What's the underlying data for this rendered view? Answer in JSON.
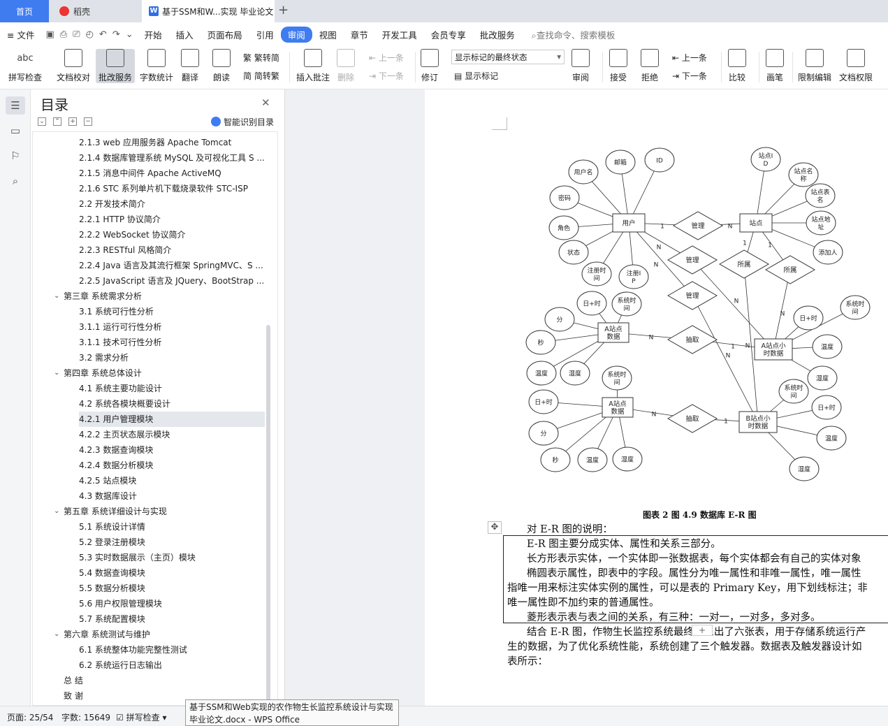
{
  "tabs": {
    "home": "首页",
    "daoke": "稻壳",
    "doc": "基于SSM和W...实现 毕业论文",
    "plus": "+"
  },
  "menu": {
    "file": "文件",
    "items": [
      "开始",
      "插入",
      "页面布局",
      "引用",
      "审阅",
      "视图",
      "章节",
      "开发工具",
      "会员专享",
      "批改服务"
    ],
    "active": "审阅",
    "search": "查找命令、搜索模板"
  },
  "ribbon": {
    "spell": "拼写检查",
    "spell_icon": "abc",
    "proof": "文档校对",
    "review_service": "批改服务",
    "wordcount": "字数统计",
    "translate": "翻译",
    "read": "朗读",
    "trad": "繁转简",
    "simp": "简转繁",
    "insert_comment": "插入批注",
    "delete": "删除",
    "prev": "上一条",
    "next": "下一条",
    "revise": "修订",
    "show_mark": "显示标记",
    "mark_state": "显示标记的最终状态",
    "review": "审阅",
    "accept": "接受",
    "reject": "拒绝",
    "prev2": "上一条",
    "next2": "下一条",
    "compare": "比较",
    "pen": "画笔",
    "restrict": "限制编辑",
    "perm": "文档权限"
  },
  "nav": {
    "title": "目录",
    "smart_toc": "智能识别目录",
    "items": [
      {
        "text": "2.1.3 web 应用服务器 Apache Tomcat",
        "level": 3
      },
      {
        "text": "2.1.4 数据库管理系统 MySQL 及可视化工具 S ...",
        "level": 3
      },
      {
        "text": "2.1.5 消息中间件 Apache ActiveMQ",
        "level": 3
      },
      {
        "text": "2.1.6 STC 系列单片机下载烧录软件 STC-ISP",
        "level": 3
      },
      {
        "text": "2.2  开发技术简介",
        "level": 3
      },
      {
        "text": "2.2.1 HTTP 协议简介",
        "level": 3
      },
      {
        "text": "2.2.2 WebSocket 协议简介",
        "level": 3
      },
      {
        "text": "2.2.3 RESTful 风格简介",
        "level": 3
      },
      {
        "text": "2.2.4 Java 语言及其流行框架 SpringMVC、S ...",
        "level": 3
      },
      {
        "text": "2.2.5 JavaScript 语言及 JQuery、BootStrap ...",
        "level": 3
      },
      {
        "text": "第三章  系统需求分析",
        "level": 1
      },
      {
        "text": "3.1  系统可行性分析",
        "level": 3
      },
      {
        "text": "3.1.1  运行可行性分析",
        "level": 3
      },
      {
        "text": "3.1.1  技术可行性分析",
        "level": 3
      },
      {
        "text": "3.2  需求分析",
        "level": 3
      },
      {
        "text": "第四章  系统总体设计",
        "level": 1
      },
      {
        "text": "4.1  系统主要功能设计",
        "level": 3
      },
      {
        "text": "4.2  系统各模块概要设计",
        "level": 3
      },
      {
        "text": "4.2.1  用户管理模块",
        "level": 3,
        "selected": true
      },
      {
        "text": "4.2.2  主页状态展示模块",
        "level": 3
      },
      {
        "text": "4.2.3  数据查询模块",
        "level": 3
      },
      {
        "text": "4.2.4  数据分析模块",
        "level": 3
      },
      {
        "text": "4.2.5  站点模块",
        "level": 3
      },
      {
        "text": "4.3  数据库设计",
        "level": 3
      },
      {
        "text": "第五章  系统详细设计与实现",
        "level": 1
      },
      {
        "text": "5.1  系统设计详情",
        "level": 3
      },
      {
        "text": "5.2  登录注册模块",
        "level": 3
      },
      {
        "text": "5.3  实时数据展示（主页）模块",
        "level": 3
      },
      {
        "text": "5.4  数据查询模块",
        "level": 3
      },
      {
        "text": "5.5  数据分析模块",
        "level": 3
      },
      {
        "text": "5.6  用户权限管理模块",
        "level": 3
      },
      {
        "text": "5.7  系统配置模块",
        "level": 3
      },
      {
        "text": "第六章  系统测试与维护",
        "level": 1
      },
      {
        "text": "6.1  系统整体功能完整性测试",
        "level": 3
      },
      {
        "text": "6.2  系统运行日志输出",
        "level": 3
      },
      {
        "text": "总   结",
        "level": 0
      },
      {
        "text": "致   谢",
        "level": 0
      }
    ]
  },
  "er": {
    "entities": [
      "用户",
      "站点",
      "A站点数据",
      "A站点小时数据",
      "A站点数据",
      "B站点小时数据"
    ],
    "relations": [
      "管理",
      "管理",
      "管理",
      "所属",
      "所属",
      "抽取",
      "抽取"
    ],
    "attrs": {
      "user": [
        "用户名",
        "邮箱",
        "ID",
        "密码",
        "角色",
        "状态",
        "注册时间",
        "注册IP"
      ],
      "site": [
        "站点ID",
        "站点名称",
        "站点表名",
        "站点地址",
        "添加人"
      ],
      "a_data": [
        "日+时",
        "系统时间",
        "分",
        "秒",
        "温度",
        "湿度"
      ],
      "a_hour": [
        "日+时",
        "系统时间",
        "温度",
        "湿度"
      ],
      "a_data2": [
        "系统时间",
        "日+时",
        "分",
        "秒",
        "温度",
        "湿度"
      ],
      "b_hour": [
        "系统时间",
        "日+时",
        "温度",
        "湿度"
      ]
    },
    "card": {
      "one": "1",
      "many": "N"
    }
  },
  "doc": {
    "caption": "图表 2 图 4.9  数据库 E-R 图",
    "lines": [
      "对 E-R 图的说明：",
      "E-R 图主要分成实体、属性和关系三部分。",
      "长方形表示实体，一个实体即一张数据表，每个实体都会有自己的实体对象",
      "椭圆表示属性，即表中的字段。属性分为唯一属性和非唯一属性，唯一属性",
      "指唯一用来标注实体实例的属性，可以是表的 Primary Key，用下划线标注；非",
      "唯一属性即不加约束的普通属性。",
      "菱形表示表与表之间的关系，有三种：一对一，一对多，多对多。",
      "结合 E-R 图，作物生长监控系统最终抽象出了六张表，用于存储系统运行产",
      "生的数据，为了优化系统性能，系统创建了三个触发器。数据表及触发器设计如",
      "表所示："
    ]
  },
  "status": {
    "page": "页面: 25/54",
    "words": "字数: 15649",
    "spell": "拼写检查"
  },
  "tooltip": {
    "line1": "基于SSM和Web实现的农作物生长监控系统设计与实现",
    "line2": "毕业论文.docx - WPS Office"
  }
}
